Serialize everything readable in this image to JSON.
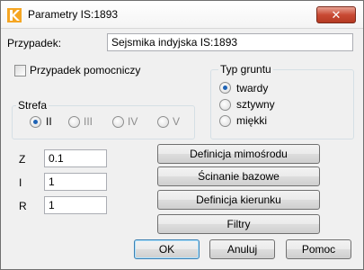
{
  "window": {
    "title": "Parametry IS:1893",
    "close_label": "✕"
  },
  "case": {
    "label": "Przypadek:",
    "value": "Sejsmika indyjska IS:1893"
  },
  "auxiliary": {
    "label": "Przypadek pomocniczy",
    "checked": false
  },
  "soil": {
    "title": "Typ gruntu",
    "options": [
      {
        "label": "twardy",
        "checked": true
      },
      {
        "label": "sztywny",
        "checked": false
      },
      {
        "label": "miękki",
        "checked": false
      }
    ]
  },
  "zone": {
    "title": "Strefa",
    "options": [
      {
        "label": "II",
        "checked": true,
        "enabled": true
      },
      {
        "label": "III",
        "checked": false,
        "enabled": false
      },
      {
        "label": "IV",
        "checked": false,
        "enabled": false
      },
      {
        "label": "V",
        "checked": false,
        "enabled": false
      }
    ]
  },
  "params": {
    "z": {
      "label": "Z",
      "value": "0.1"
    },
    "i": {
      "label": "I",
      "value": "1"
    },
    "r": {
      "label": "R",
      "value": "1"
    }
  },
  "actions": {
    "eccentricity": "Definicja mimośrodu",
    "base_shear": "Ścinanie bazowe",
    "direction": "Definicja kierunku",
    "filters": "Filtry"
  },
  "footer": {
    "ok": "OK",
    "cancel": "Anuluj",
    "help": "Pomoc"
  },
  "colors": {
    "close_button": "#c94a34",
    "radio_dot": "#1e63b5",
    "icon_accent": "#f5a623"
  }
}
